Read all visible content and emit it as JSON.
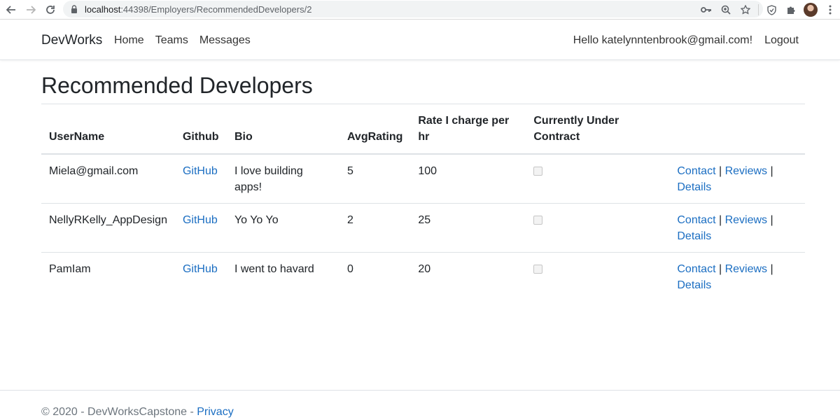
{
  "browser": {
    "url_host": "localhost",
    "url_path": ":44398/Employers/RecommendedDevelopers/2"
  },
  "navbar": {
    "brand": "DevWorks",
    "links": [
      "Home",
      "Teams",
      "Messages"
    ],
    "greeting": "Hello katelynntenbrook@gmail.com!",
    "logout": "Logout"
  },
  "page": {
    "title": "Recommended Developers"
  },
  "table": {
    "headers": [
      "UserName",
      "Github",
      "Bio",
      "AvgRating",
      "Rate I charge per hr",
      "Currently Under Contract"
    ],
    "rows": [
      {
        "username": "Miela@gmail.com",
        "github": "GitHub",
        "bio": "I love building apps!",
        "rating": "5",
        "rate": "100",
        "under_contract": false
      },
      {
        "username": "NellyRKelly_AppDesign",
        "github": "GitHub",
        "bio": "Yo Yo Yo",
        "rating": "2",
        "rate": "25",
        "under_contract": false
      },
      {
        "username": "PamIam",
        "github": "GitHub",
        "bio": "I went to havard",
        "rating": "0",
        "rate": "20",
        "under_contract": false
      }
    ],
    "actions": {
      "contact": "Contact",
      "reviews": "Reviews",
      "details": "Details",
      "separator": "|"
    }
  },
  "footer": {
    "copyright": "© 2020 - DevWorksCapstone - ",
    "privacy": "Privacy"
  },
  "colors": {
    "link": "#1b6ec2",
    "text": "#212529",
    "muted": "#6c757d",
    "border": "#dee2e6"
  }
}
